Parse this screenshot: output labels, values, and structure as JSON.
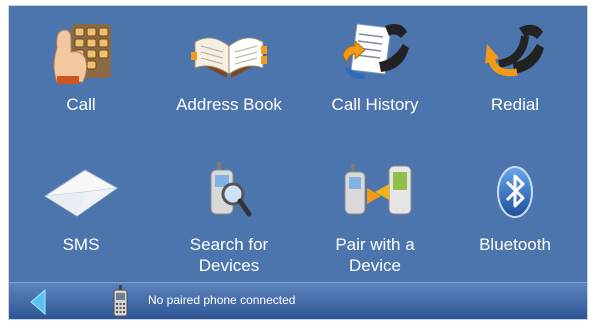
{
  "menu": {
    "items": [
      {
        "id": "call",
        "label_lines": [
          "Call"
        ],
        "icon": "dialpad-hand-icon"
      },
      {
        "id": "address-book",
        "label_lines": [
          "Address Book"
        ],
        "icon": "open-book-icon"
      },
      {
        "id": "call-history",
        "label_lines": [
          "Call History"
        ],
        "icon": "history-document-phone-icon"
      },
      {
        "id": "redial",
        "label_lines": [
          "Redial"
        ],
        "icon": "redial-arrow-phone-icon"
      },
      {
        "id": "sms",
        "label_lines": [
          "SMS"
        ],
        "icon": "envelope-icon"
      },
      {
        "id": "search-devices",
        "label_lines": [
          "Search for",
          "Devices"
        ],
        "icon": "phone-magnifier-icon"
      },
      {
        "id": "pair-device",
        "label_lines": [
          "Pair with a",
          "Device"
        ],
        "icon": "pair-phones-icon"
      },
      {
        "id": "bluetooth",
        "label_lines": [
          "Bluetooth"
        ],
        "icon": "bluetooth-icon"
      }
    ]
  },
  "statusbar": {
    "text": "No paired phone connected",
    "back_icon": "back-arrow-icon",
    "phone_icon": "mobile-phone-icon"
  },
  "colors": {
    "background": "#4c74ad",
    "statusbar": "#2d5696",
    "text": "#ffffff"
  }
}
